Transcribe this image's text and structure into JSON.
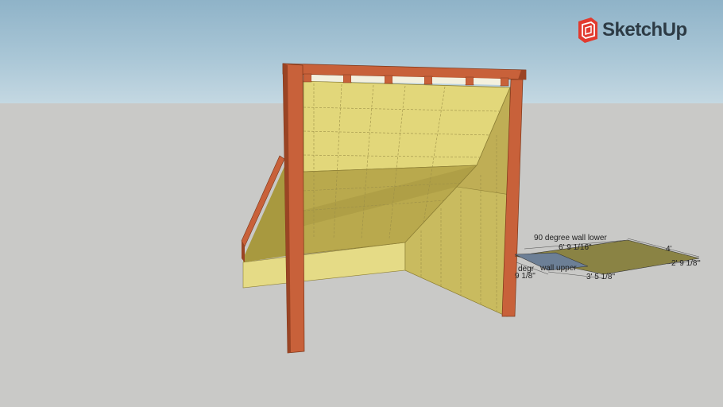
{
  "app": {
    "logo_text": "SketchUp",
    "logo_icon": "sketchup-logo-icon"
  },
  "scene": {
    "colors": {
      "sky_top": "#8fb3c8",
      "sky_bottom": "#c4d8e2",
      "ground": "#c9c9c7",
      "wood": "#c8613a",
      "wood_dark": "#9a4424",
      "panel": "#e2d77a",
      "panel_shade": "#bfae55",
      "panel_dark": "#9e8f3e",
      "floor_panel": "#8a8344",
      "floor_blue": "#6c7f96"
    }
  },
  "dimensions": {
    "label_title": "90 degree wall lower",
    "label_length_top": "6' 9 1/16\"",
    "label_right_top": "4'",
    "label_right_side": "2' 9 1/8\"",
    "label_left_a": "degr",
    "label_left_b": "wall upper",
    "label_left_c": "9 1/8\"",
    "label_bottom": "3' 5 1/8\""
  }
}
